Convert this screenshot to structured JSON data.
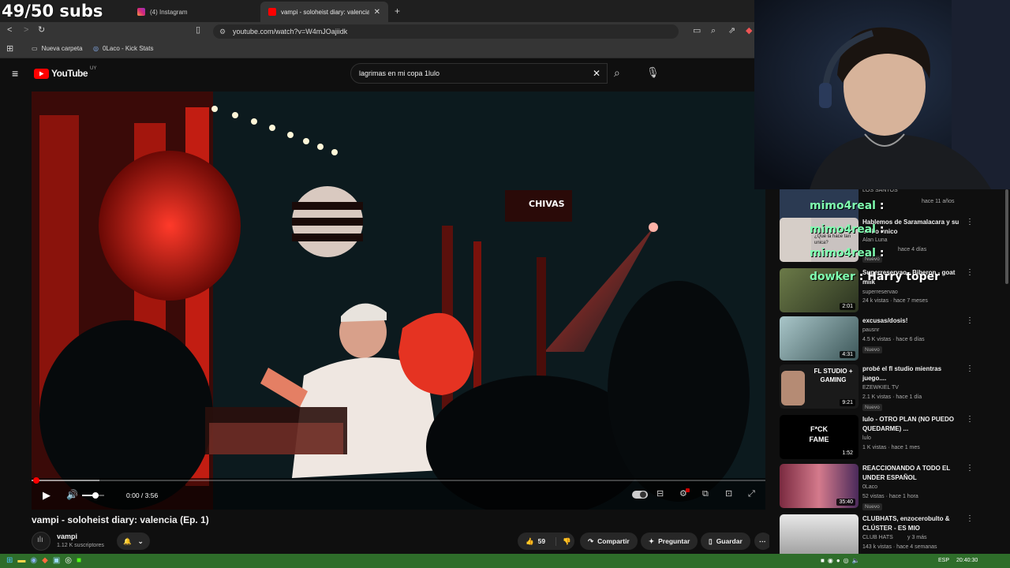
{
  "stream_overlay": {
    "subs_goal": "49/50 subs",
    "chat_msgs": [
      {
        "user": "mimo4real",
        "sep": " : "
      },
      {
        "user": "mimo4real",
        "sep": " : "
      },
      {
        "user": "mimo4real",
        "sep": " : "
      },
      {
        "user": "dowker",
        "sep": " : ",
        "text": "Harry toper"
      }
    ],
    "chat_user_color": "#7fffb0"
  },
  "browser": {
    "tabs": [
      {
        "label": "(4) Instagram",
        "icon": "instagram-icon"
      },
      {
        "label": "vampi - soloheist diary: valencia",
        "icon": "youtube-icon",
        "active": true
      }
    ],
    "new_tab": "+",
    "url": "youtube.com/watch?v=W4mJOajiidk",
    "bookmarks": [
      {
        "label": "Nueva carpeta",
        "icon": "folder-icon"
      },
      {
        "label": "0Laco - Kick Stats",
        "icon": "kick-icon"
      }
    ]
  },
  "youtube": {
    "logo_text": "YouTube",
    "region": "UY",
    "search_value": "lagrimas en mi copa 1lulo",
    "accent": "#ff0000"
  },
  "player": {
    "time": "0:00 / 3:56",
    "progress": 0.0,
    "volume": 0.6,
    "scene_sign": "CHIVAS"
  },
  "video": {
    "title": "vampi - soloheist diary: valencia (Ep. 1)",
    "channel": "vampi",
    "subscribers": "1.12 K suscriptores",
    "likes": "59",
    "share": "Compartir",
    "ask": "Preguntar",
    "save": "Guardar"
  },
  "sidebar": {
    "items": [
      {
        "title": "LOS SANTOS",
        "channel": "",
        "meta": "hace 11 años",
        "duration": "",
        "new": ""
      },
      {
        "title": "Hablemos de Saramalacara y su estilo único",
        "channel": "Alan Luna",
        "meta": "hace 4 días",
        "duration": "",
        "new": "Nuevo",
        "thumb_text": "¿Que la hace tan unica?"
      },
      {
        "title": "Superreservao - Biberon - goat milk",
        "channel": "superreservao",
        "meta": "24 k vistas · hace 7 meses",
        "duration": "2:01",
        "new": ""
      },
      {
        "title": "excusas/dosis!",
        "channel": "pausnr",
        "meta": "4.5 K vistas · hace 6 días",
        "duration": "4:31",
        "new": "Nuevo"
      },
      {
        "title": "probé el fl studio mientras juego....",
        "channel": "EZEWKIEL TV",
        "meta": "2.1 K vistas · hace 1 día",
        "duration": "9:21",
        "new": "Nuevo",
        "thumb_text": "FL STUDIO + GAMING"
      },
      {
        "title": "lulo - OTRO PLAN (NO PUEDO QUEDARME) ...",
        "channel": "lulo",
        "meta": "1 K vistas · hace 1 mes",
        "duration": "1:52",
        "new": "",
        "thumb_text": "F*CK FAME"
      },
      {
        "title": "REACCIONANDO A TODO EL UNDER ESPAÑOL",
        "channel": "0Laco",
        "meta": "52 vistas · hace 1 hora",
        "duration": "35:40",
        "new": "Nuevo"
      },
      {
        "title": "CLUBHATS, enzocerobulto & CLÚSTER - ES MIO",
        "channel": "CLUB HATS",
        "meta": "143 k vistas · hace 4 semanas",
        "duration": "",
        "new": "",
        "extra": "y 3 más"
      }
    ]
  },
  "taskbar": {
    "lang": "ESP",
    "time": "20:40:30"
  }
}
